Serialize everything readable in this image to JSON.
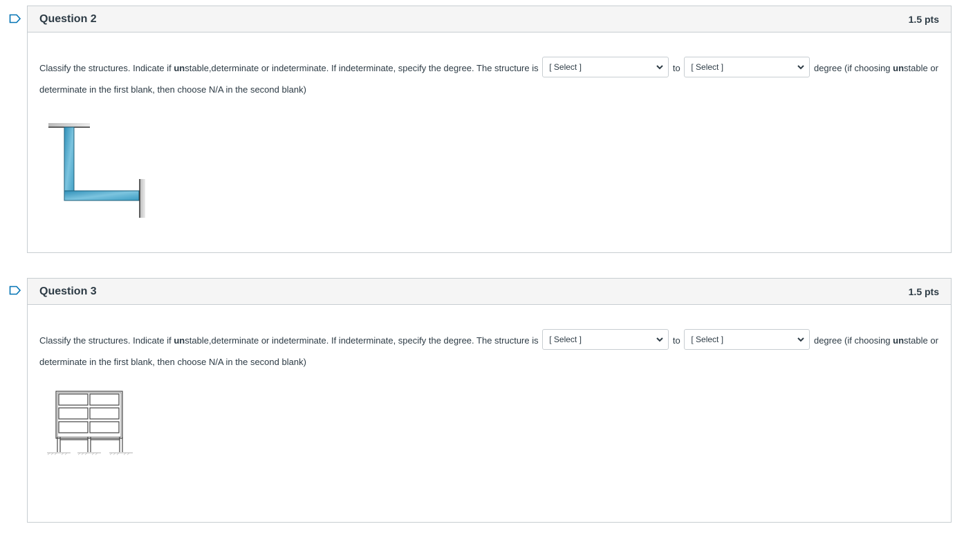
{
  "questions": [
    {
      "title": "Question 2",
      "points": "1.5 pts",
      "text_before": "Classify the structures. Indicate if ",
      "text_bold": "un",
      "text_mid": "stable,determinate or indeterminate. If indeterminate, specify the degree. The structure is",
      "select1": "[ Select ]",
      "text_to": "to",
      "select2": "[ Select ]",
      "text_after1": "degree (if choosing ",
      "text_bold2": "un",
      "text_after2": "stable or determinate in the first blank, then choose N/A in the second blank)",
      "figure_icon": "l-frame-fixed-supports-diagram"
    },
    {
      "title": "Question 3",
      "points": "1.5 pts",
      "text_before": "Classify the structures. Indicate if ",
      "text_bold": "un",
      "text_mid": "stable,determinate or indeterminate. If indeterminate, specify the degree. The structure is",
      "select1": "[ Select ]",
      "text_to": "to",
      "select2": "[ Select ]",
      "text_after1": "degree (if choosing ",
      "text_bold2": "un",
      "text_after2": "stable or determinate in the first blank, then choose N/A in the second blank)",
      "figure_icon": "three-story-two-bay-frame-diagram"
    }
  ],
  "colors": {
    "border": "#c7cdd1",
    "header_bg": "#f5f5f5",
    "text": "#2d3b45",
    "flag": "#0374b5",
    "beam": "#3fa1c4"
  }
}
